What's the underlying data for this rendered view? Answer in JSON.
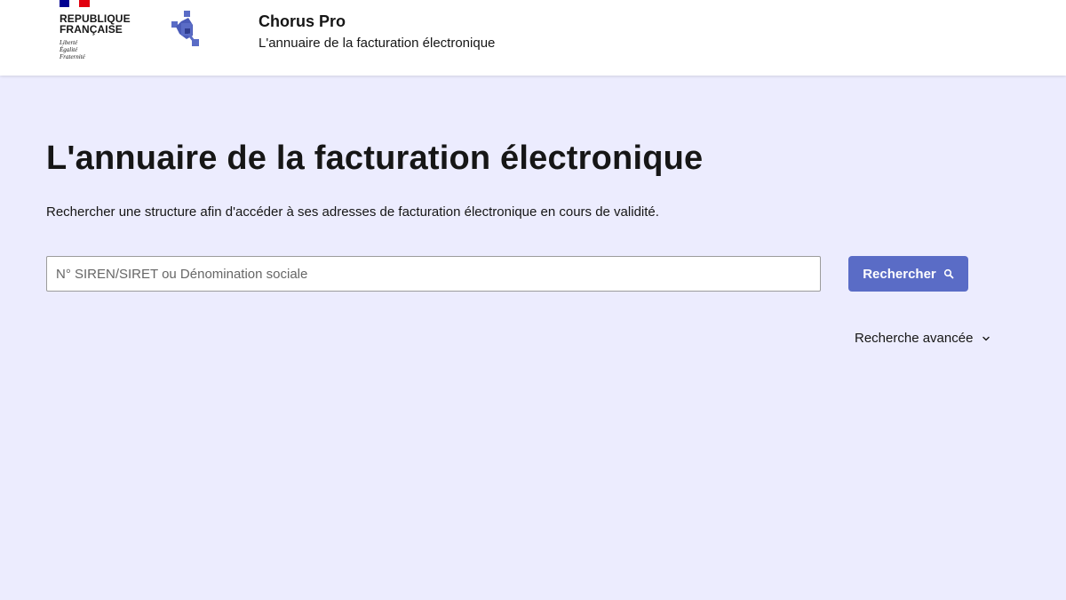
{
  "header": {
    "rf_title_line1": "REPUBLIQUE",
    "rf_title_line2": "FRANÇAISE",
    "rf_motto_line1": "Liberté",
    "rf_motto_line2": "Égalité",
    "rf_motto_line3": "Fraternité",
    "app_name": "Chorus Pro",
    "app_tagline": "L'annuaire de la facturation électronique"
  },
  "main": {
    "title": "L'annuaire de la facturation électronique",
    "description": "Rechercher une structure afin d'accéder à ses adresses de facturation électronique en cours de validité.",
    "search": {
      "placeholder": "N° SIREN/SIRET ou Dénomination sociale",
      "value": "",
      "button_label": "Rechercher",
      "button_icon": "search-icon"
    },
    "advanced_search": {
      "label": "Recherche avancée",
      "icon": "chevron-down-icon"
    }
  },
  "colors": {
    "background": "#ececfe",
    "header": "#ffffff",
    "button": "#5a6cc6",
    "logo_blue": "#5a6cc6",
    "flag_blue": "#000091",
    "flag_red": "#e1000f"
  }
}
